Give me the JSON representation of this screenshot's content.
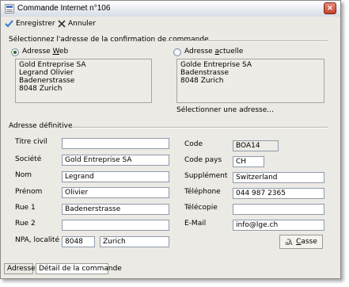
{
  "window": {
    "title": "Commande Internet n°106",
    "close_label": "×"
  },
  "toolbar": {
    "save_label": "Enregistrer",
    "cancel_label": "Annuler"
  },
  "confirmation": {
    "section_title": "Sélectionnez l'adresse de la confirmation de commande",
    "web_option": {
      "label_prefix": "Adresse ",
      "label_hotkey": "W",
      "label_suffix": "eb",
      "selected": true
    },
    "current_option": {
      "label_prefix": "Adresse ",
      "label_hotkey": "a",
      "label_suffix": "ctuelle",
      "selected": false
    },
    "web_address": [
      "Gold Entreprise SA",
      "Legrand Olivier",
      "Badenerstrasse",
      "8048 Zurich"
    ],
    "current_address": [
      "Golde Entreprise SA",
      "Badenstrasse",
      "8048 Zurich"
    ],
    "select_address_link": "Sélectionner une adresse..."
  },
  "final_address": {
    "section_title": "Adresse définitive",
    "titre_civil": {
      "label": "Titre civil",
      "value": ""
    },
    "societe": {
      "label": "Société",
      "value": "Gold Entreprise SA"
    },
    "nom": {
      "label": "Nom",
      "value": "Legrand"
    },
    "prenom": {
      "label": "Prénom",
      "value": "Olivier"
    },
    "rue1": {
      "label": "Rue 1",
      "value": "Badenerstrasse"
    },
    "rue2": {
      "label": "Rue 2",
      "value": ""
    },
    "npa_localite": {
      "label": "NPA, localité",
      "npa": "8048",
      "localite": "Zurich"
    },
    "code": {
      "label": "Code",
      "value": "BOA14"
    },
    "code_pays": {
      "label": "Code pays",
      "value": "CH"
    },
    "supplement": {
      "label": "Supplément",
      "value": "Switzerland"
    },
    "telephone": {
      "label": "Téléphone",
      "value": "044 987 2365"
    },
    "telecopie": {
      "label": "Télécopie",
      "value": ""
    },
    "email": {
      "label": "E-Mail",
      "value": "info@lge.ch"
    },
    "casse_button": {
      "label_hotkey": "C",
      "label_rest": "asse"
    }
  },
  "tabs": [
    "Adresse",
    "Détail de la commande"
  ],
  "colors": {
    "title_gradient_top": "#ffffff",
    "title_gradient_bottom": "#d7dde6",
    "dialog_bg": "#eceae4",
    "close_red": "#c3412c"
  }
}
